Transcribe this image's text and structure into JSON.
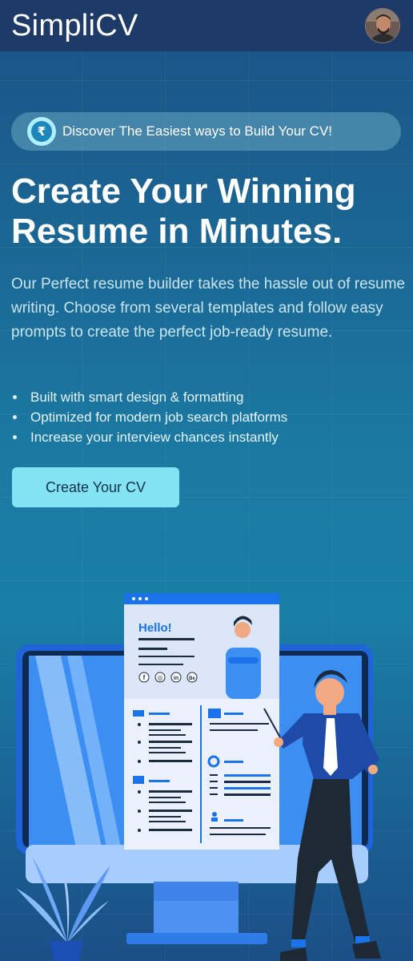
{
  "nav": {
    "brand": "SimpliCV"
  },
  "hero": {
    "pill_icon_symbol": "₹",
    "pill_text": "Discover The Easiest ways to Build Your CV!",
    "headline_line1": "Create Your Winning",
    "headline_line2": "Resume in Minutes.",
    "description": "Our Perfect resume builder takes the hassle out of resume writing. Choose from several templates and follow easy prompts to create the perfect job-ready resume.",
    "bullets": [
      "Built with smart design & formatting",
      "Optimized for modern job search platforms",
      "Increase your interview chances instantly"
    ],
    "cta_label": "Create Your CV"
  },
  "illustration": {
    "resume_greeting": "Hello!",
    "social_icons": [
      "f",
      "◎",
      "in",
      "Be"
    ]
  },
  "colors": {
    "nav_bg": "#1e3a66",
    "cta_bg": "#84e2f2",
    "accent_blue": "#1a73e8"
  }
}
